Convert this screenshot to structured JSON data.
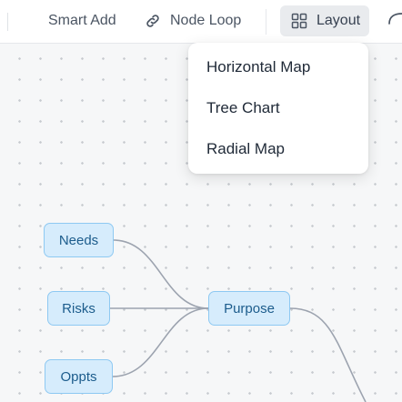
{
  "toolbar": {
    "smart_add_label": "Smart Add",
    "node_loop_label": "Node Loop",
    "layout_label": "Layout"
  },
  "icons": {
    "node_loop": "link-icon",
    "layout": "grid-icon",
    "extra": "curve-icon"
  },
  "layout_menu": {
    "items": [
      {
        "label": "Horizontal Map"
      },
      {
        "label": "Tree Chart"
      },
      {
        "label": "Radial Map"
      }
    ]
  },
  "mindmap": {
    "nodes": [
      {
        "id": "needs",
        "label": "Needs"
      },
      {
        "id": "risks",
        "label": "Risks"
      },
      {
        "id": "oppts",
        "label": "Oppts"
      },
      {
        "id": "purpose",
        "label": "Purpose"
      }
    ]
  },
  "colors": {
    "node_fill": "#d6ecfc",
    "node_border": "#8ec9f2",
    "node_text": "#1c5c8c",
    "edge": "#9ca3af"
  }
}
